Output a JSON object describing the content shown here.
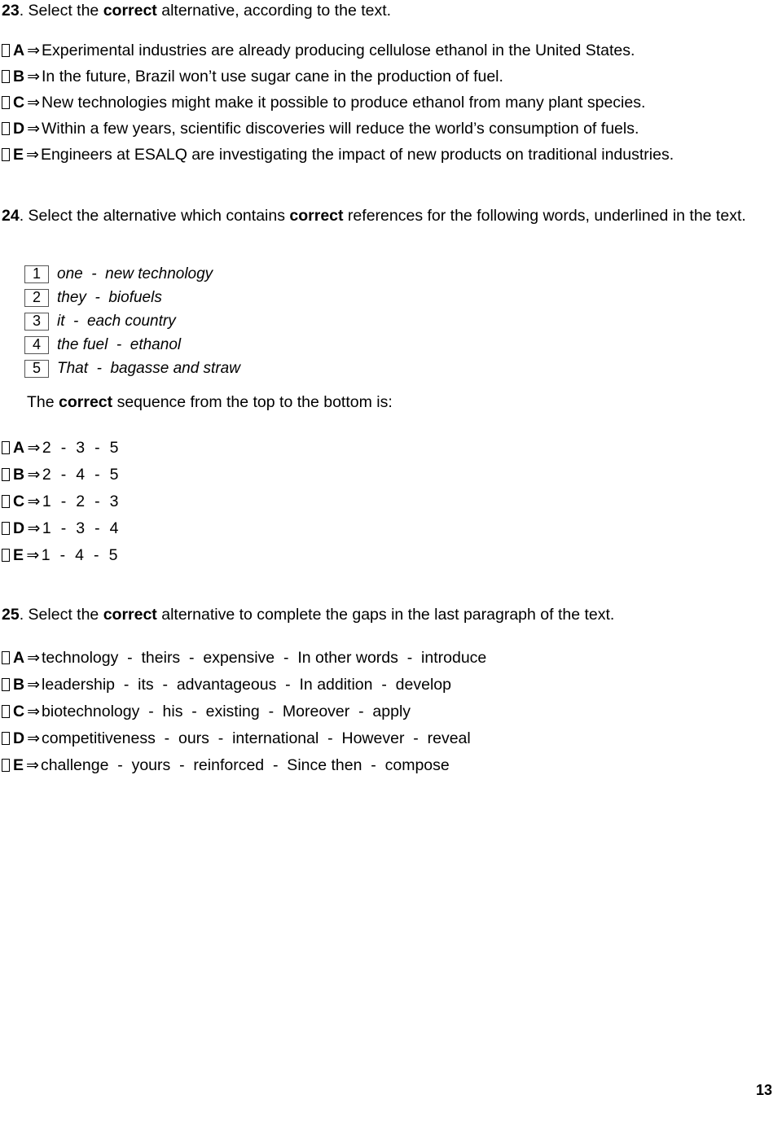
{
  "page": {
    "number": "13"
  },
  "questions": [
    {
      "id": "q23",
      "number": "23",
      "prompt_pre": ". Select the ",
      "prompt_bold": "correct",
      "prompt_post": " alternative, according to the text.",
      "arrow": "⇒",
      "options": [
        {
          "letter": "A",
          "text": "Experimental industries are already producing cellulose ethanol in the United States."
        },
        {
          "letter": "B",
          "text": "In the future, Brazil won’t use sugar cane in the production of fuel."
        },
        {
          "letter": "C",
          "text": "New technologies might make it possible to produce ethanol from many plant species."
        },
        {
          "letter": "D",
          "text": "Within a few years, scientific discoveries will reduce the world’s consumption of fuels."
        },
        {
          "letter": "E",
          "text": "Engineers at ESALQ are investigating the impact of new products on traditional industries."
        }
      ]
    },
    {
      "id": "q24",
      "number": "24",
      "prompt_pre": ". Select the alternative which contains ",
      "prompt_bold": "correct",
      "prompt_post": " references for the following words, underlined in the text.",
      "arrow": "⇒",
      "items": [
        {
          "num": "1",
          "text": "one  -  new technology"
        },
        {
          "num": "2",
          "text": "they  -  biofuels"
        },
        {
          "num": "3",
          "text": "it  -  each country"
        },
        {
          "num": "4",
          "text": "the fuel  -  ethanol"
        },
        {
          "num": "5",
          "text": "That  -  bagasse and straw"
        }
      ],
      "sequence_prompt_pre": "The ",
      "sequence_prompt_bold": "correct",
      "sequence_prompt_post": " sequence from the top to the bottom is:",
      "options": [
        {
          "letter": "A",
          "text": "2  -  3  -  5"
        },
        {
          "letter": "B",
          "text": "2  -  4  -  5"
        },
        {
          "letter": "C",
          "text": "1  -  2  -  3"
        },
        {
          "letter": "D",
          "text": "1  -  3  -  4"
        },
        {
          "letter": "E",
          "text": "1  -  4  -  5"
        }
      ]
    },
    {
      "id": "q25",
      "number": "25",
      "prompt_pre": ". Select the ",
      "prompt_bold": "correct",
      "prompt_post": " alternative to complete the gaps in the last paragraph of the text.",
      "arrow": "⇒",
      "options": [
        {
          "letter": "A",
          "text": "technology  -  theirs  -  expensive  -  In other words  -  introduce"
        },
        {
          "letter": "B",
          "text": "leadership  -  its  -  advantageous  -  In addition  -  develop"
        },
        {
          "letter": "C",
          "text": "biotechnology  -  his  -  existing  -  Moreover  -  apply"
        },
        {
          "letter": "D",
          "text": "competitiveness  -  ours  -  international  -  However  -  reveal"
        },
        {
          "letter": "E",
          "text": "challenge  -  yours  -  reinforced  -  Since then  -  compose"
        }
      ]
    }
  ]
}
